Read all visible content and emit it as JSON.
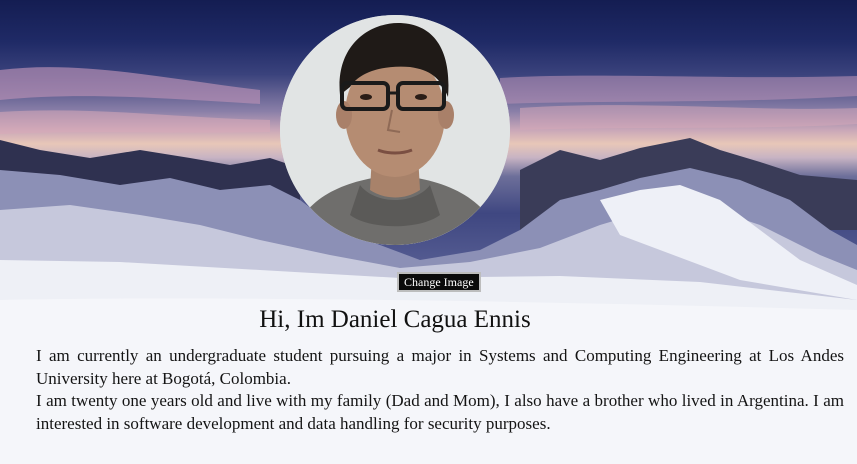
{
  "profile": {
    "avatar_alt": "Profile photo",
    "change_image_label": "Change Image",
    "heading": "Hi, Im Daniel Cagua Ennis",
    "bio": [
      "I am currently an undergraduate student pursuing a major in Systems and Computing Engineering at Los Andes University here at Bogotá, Colombia.",
      "I am twenty one years old and live with my family (Dad and Mom), I also have a brother who lived in Argentina. I am interested in software development and data handling for security purposes."
    ]
  },
  "background": {
    "sky_top": "#141d52",
    "sunset_band": "#e8c7b8",
    "snow": "#f3f4f8"
  }
}
